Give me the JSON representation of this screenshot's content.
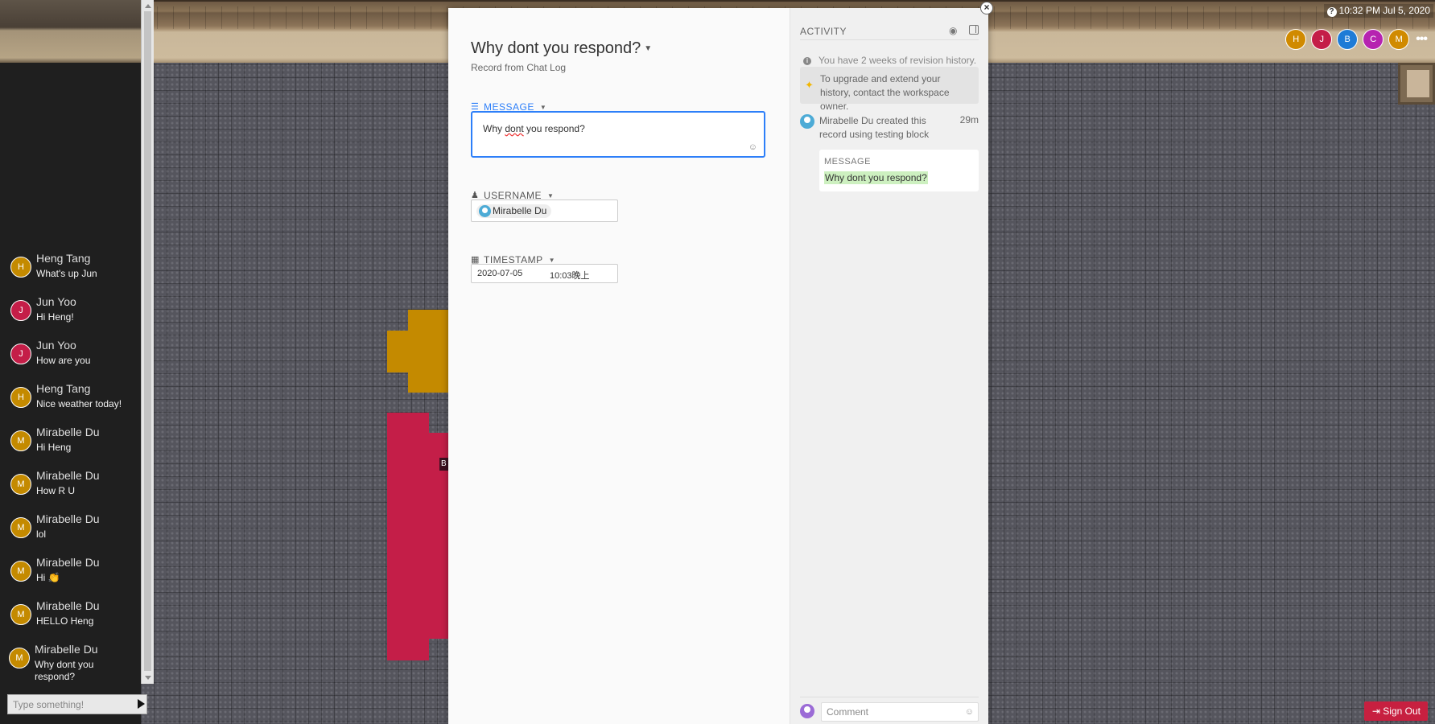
{
  "clock": "10:32 PM Jul 5, 2020",
  "top_users": [
    {
      "initial": "H",
      "color": "#d08a00"
    },
    {
      "initial": "J",
      "color": "#c41e48"
    },
    {
      "initial": "B",
      "color": "#1e7bd6"
    },
    {
      "initial": "C",
      "color": "#b623b0"
    },
    {
      "initial": "M",
      "color": "#d08a00"
    }
  ],
  "more_label": "•••",
  "sign_out_label": "Sign Out",
  "chat": {
    "messages": [
      {
        "initial": "H",
        "color": "#c48a00",
        "name": "Heng Tang",
        "text": "What's up Jun"
      },
      {
        "initial": "J",
        "color": "#c41e48",
        "name": "Jun Yoo",
        "text": "Hi Heng!"
      },
      {
        "initial": "J",
        "color": "#c41e48",
        "name": "Jun Yoo",
        "text": "How are you"
      },
      {
        "initial": "H",
        "color": "#c48a00",
        "name": "Heng Tang",
        "text": "Nice weather today!"
      },
      {
        "initial": "M",
        "color": "#c48a00",
        "name": "Mirabelle Du",
        "text": "Hi Heng"
      },
      {
        "initial": "M",
        "color": "#c48a00",
        "name": "Mirabelle Du",
        "text": "How R U"
      },
      {
        "initial": "M",
        "color": "#c48a00",
        "name": "Mirabelle Du",
        "text": "lol"
      },
      {
        "initial": "M",
        "color": "#c48a00",
        "name": "Mirabelle Du",
        "text": "Hi 👏"
      },
      {
        "initial": "M",
        "color": "#c48a00",
        "name": "Mirabelle Du",
        "text": "HELLO Heng"
      },
      {
        "initial": "M",
        "color": "#c48a00",
        "name": "Mirabelle Du",
        "text": "Why dont you respond?"
      }
    ],
    "input_placeholder": "Type something!"
  },
  "shape_label": "B",
  "record": {
    "title": "Why dont you respond?",
    "subtitle": "Record from Chat Log",
    "message_label": "MESSAGE",
    "message_value_before": "Why ",
    "message_value_squiggle": "dont",
    "message_value_after": " you respond?",
    "username_label": "USERNAME",
    "username_value": "Mirabelle Du",
    "timestamp_label": "TIMESTAMP",
    "timestamp_date": "2020-07-05",
    "timestamp_time": "10:03晚上"
  },
  "activity": {
    "header": "ACTIVITY",
    "revision_note": "You have 2 weeks of revision history.",
    "upgrade_text": "To upgrade and extend your history, contact the workspace owner.",
    "entry_text": "Mirabelle Du created this record using testing block",
    "entry_time": "29m",
    "entry_field": "MESSAGE",
    "entry_value": "Why dont you respond?",
    "comment_placeholder": "Comment"
  }
}
